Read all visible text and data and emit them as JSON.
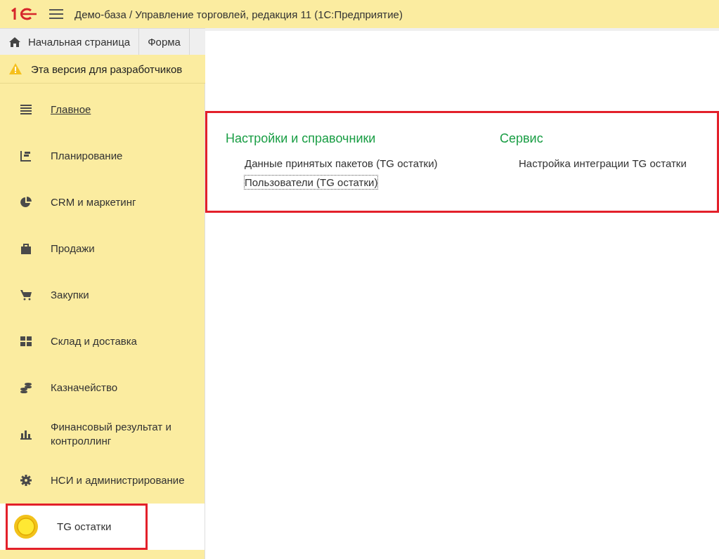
{
  "window": {
    "title": "Демо-база / Управление торговлей, редакция 11  (1С:Предприятие)"
  },
  "tabs": [
    {
      "label": "Начальная страница",
      "kind": "home",
      "selected": false
    },
    {
      "label": "Форма",
      "kind": "plain",
      "selected": false
    }
  ],
  "warning": {
    "text": "Эта версия для разработчиков"
  },
  "sidebar": {
    "items": [
      {
        "label": "Главное",
        "kind": "list",
        "selected": false,
        "hovered": true,
        "highlighted": false
      },
      {
        "label": "Планирование",
        "kind": "plan",
        "selected": false,
        "hovered": false,
        "highlighted": false
      },
      {
        "label": "CRM и маркетинг",
        "kind": "pie",
        "selected": false,
        "hovered": false,
        "highlighted": false
      },
      {
        "label": "Продажи",
        "kind": "bag",
        "selected": false,
        "hovered": false,
        "highlighted": false
      },
      {
        "label": "Закупки",
        "kind": "cart",
        "selected": false,
        "hovered": false,
        "highlighted": false
      },
      {
        "label": "Склад и доставка",
        "kind": "grid",
        "selected": false,
        "hovered": false,
        "highlighted": false
      },
      {
        "label": "Казначейство",
        "kind": "coins",
        "selected": false,
        "hovered": false,
        "highlighted": false
      },
      {
        "label": "Финансовый результат и контроллинг",
        "kind": "bars",
        "selected": false,
        "hovered": false,
        "highlighted": false
      },
      {
        "label": "НСИ и администрирование",
        "kind": "gear",
        "selected": false,
        "hovered": false,
        "highlighted": false
      },
      {
        "label": "TG остатки",
        "kind": "circle",
        "selected": true,
        "hovered": false,
        "highlighted": true
      }
    ]
  },
  "panel": {
    "highlighted": true,
    "sections": [
      {
        "title": "Настройки и справочники",
        "links": [
          {
            "label": "Данные принятых пакетов (TG остатки)",
            "focused": false
          },
          {
            "label": "Пользователи (TG остатки)",
            "focused": true
          }
        ]
      },
      {
        "title": "Сервис",
        "links": [
          {
            "label": "Настройка интеграции TG остатки",
            "focused": false
          }
        ]
      }
    ]
  }
}
